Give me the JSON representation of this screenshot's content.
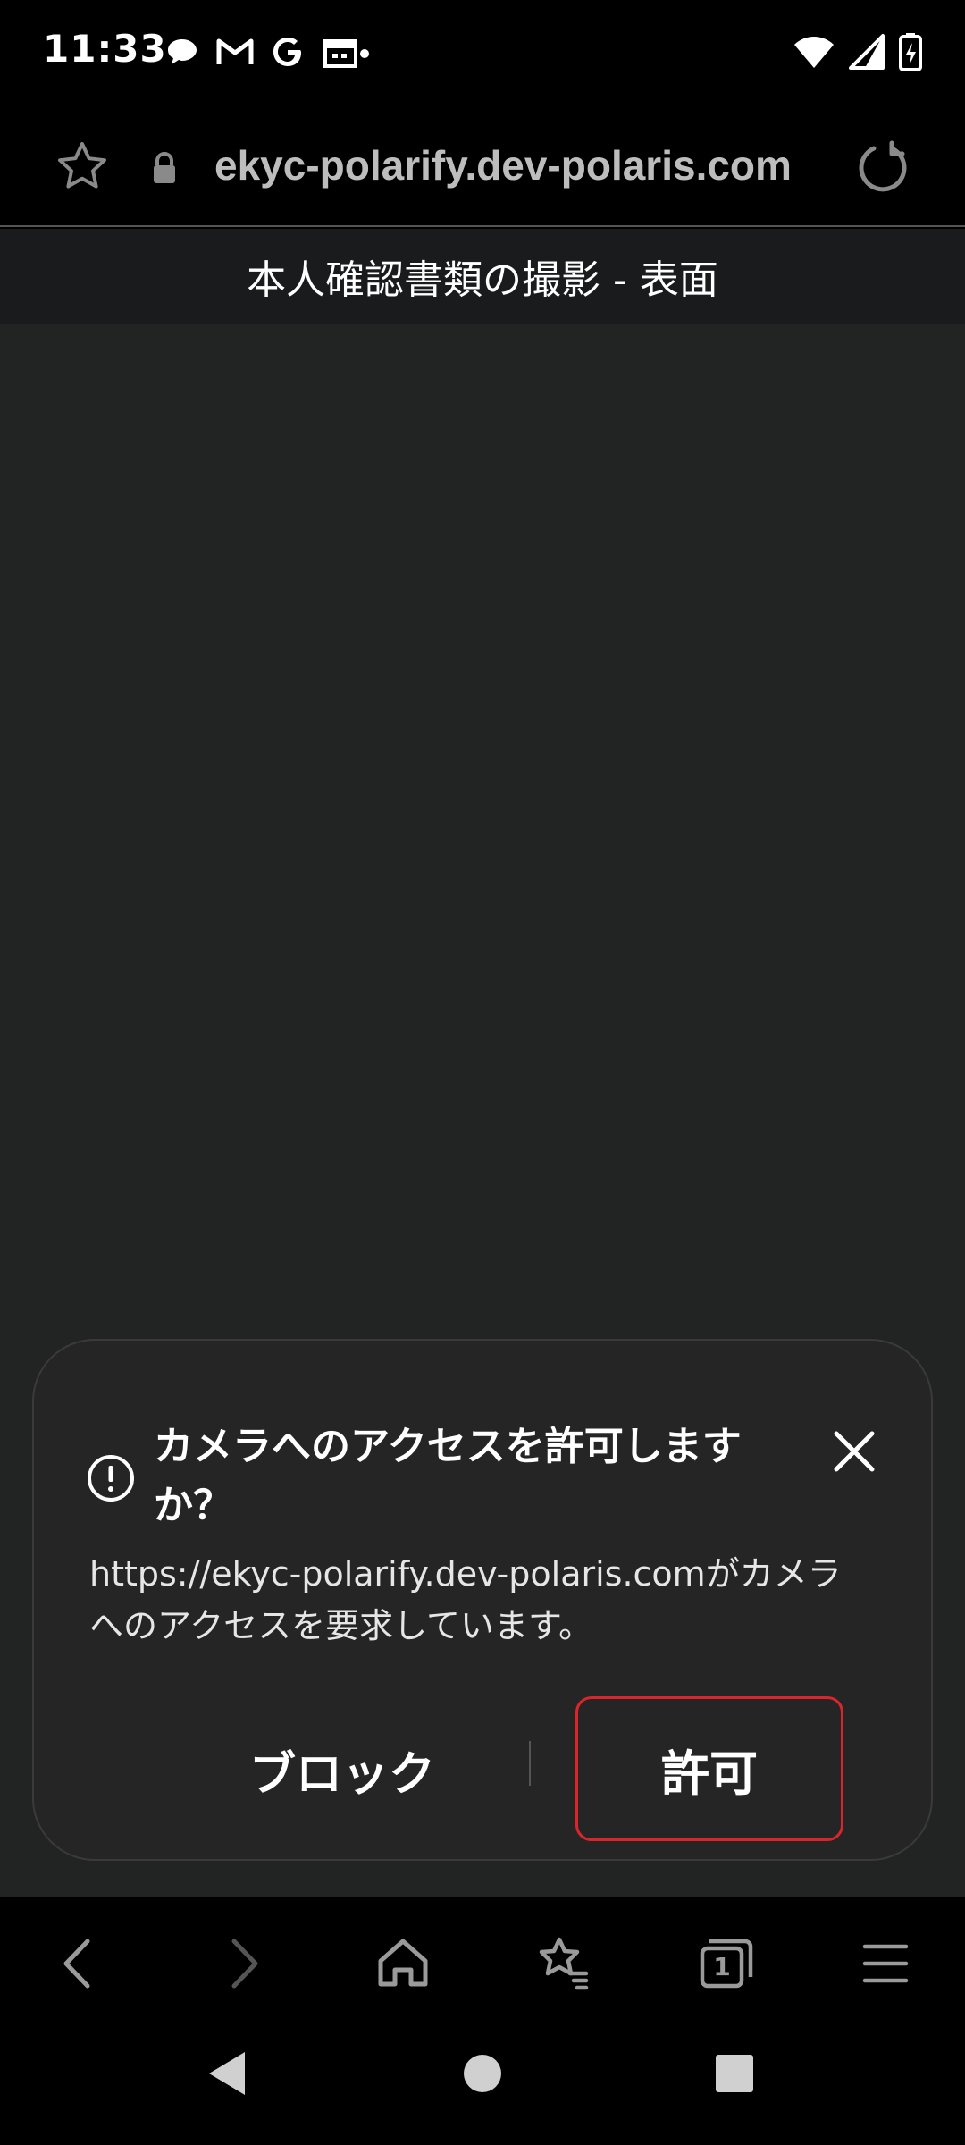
{
  "status_bar": {
    "time": "11:33",
    "left_icons": [
      "chat-bubble-icon",
      "gmail-icon",
      "google-icon",
      "calendar-icon",
      "dot-icon"
    ],
    "right_icons": [
      "wifi-icon",
      "signal-icon",
      "battery-charging-icon"
    ]
  },
  "address_bar": {
    "url": "ekyc-polarify.dev-polaris.com",
    "icons": [
      "star-icon",
      "lock-icon",
      "reload-icon"
    ]
  },
  "page": {
    "title": "本人確認書類の撮影 - 表面"
  },
  "permission_dialog": {
    "title": "カメラへのアクセスを許可しますか？",
    "message": "https://ekyc-polarify.dev-polaris.comがカメラへのアクセスを要求しています。",
    "block_label": "ブロック",
    "allow_label": "許可",
    "allow_highlight_color": "#d9262c"
  },
  "browser_toolbar": {
    "items": [
      "back-icon",
      "forward-icon",
      "home-icon",
      "bookmarks-icon",
      "tabs-icon",
      "menu-icon"
    ],
    "tab_count": "1"
  },
  "system_nav": {
    "items": [
      "back-triangle-icon",
      "home-circle-icon",
      "recents-square-icon"
    ]
  }
}
